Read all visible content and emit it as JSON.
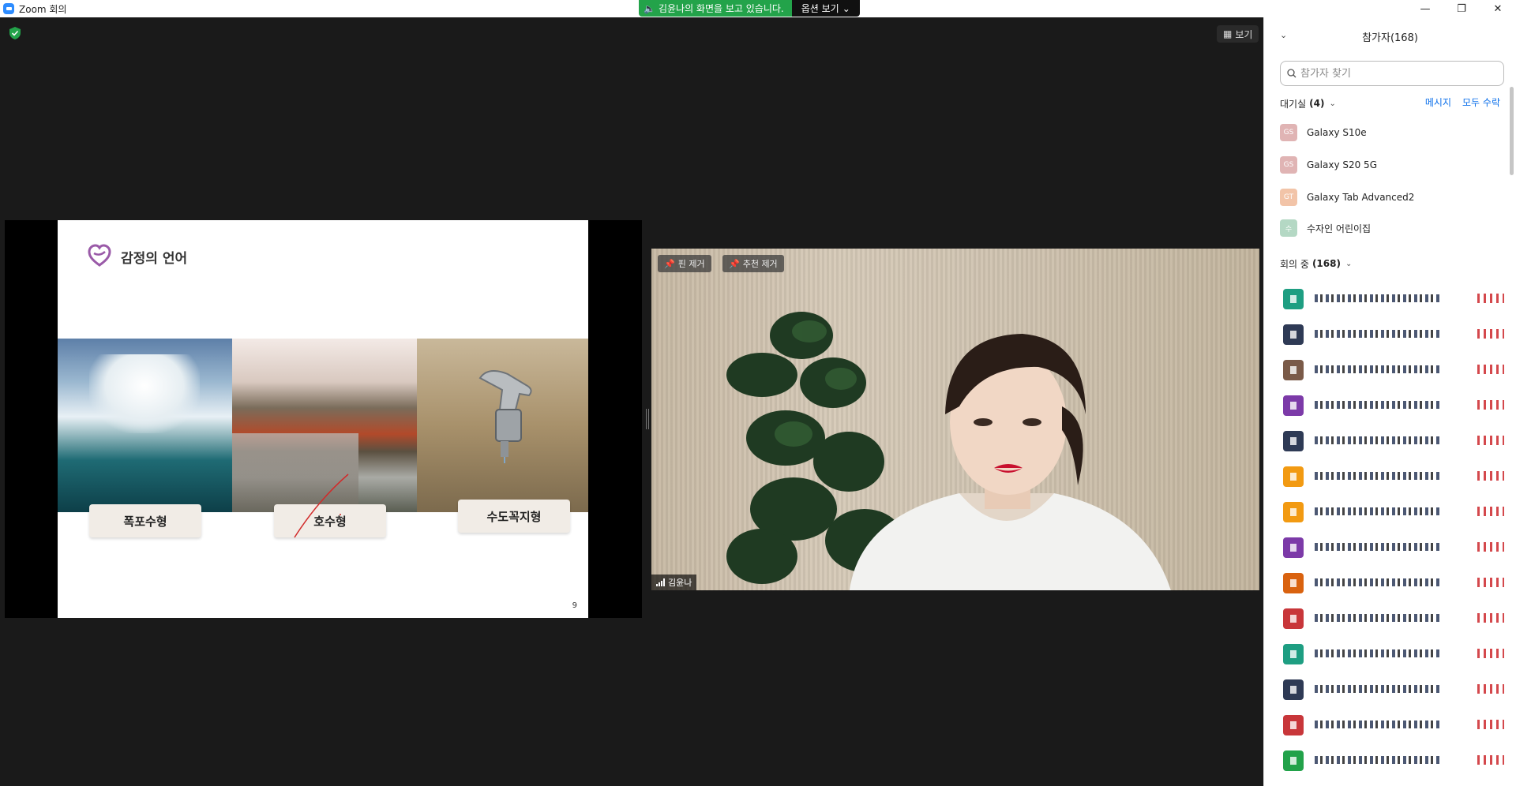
{
  "window": {
    "title": "Zoom 회의",
    "controls": {
      "minimize": "—",
      "restore": "❐",
      "close": "✕"
    }
  },
  "share_banner": {
    "text": "김윤나의 화면을 보고 있습니다.",
    "options_label": "옵션 보기"
  },
  "toolbar": {
    "view_label": "보기"
  },
  "slide": {
    "title": "감정의 언어",
    "labels": [
      "폭포수형",
      "호수형",
      "수도꼭지형"
    ],
    "page": "9"
  },
  "video": {
    "unpin_label": "핀 제거",
    "unspotlight_label": "추천 제거",
    "speaker_name": "김윤나"
  },
  "participants": {
    "title": "참가자(168)",
    "search_placeholder": "참가자 찾기",
    "waiting_room": {
      "label": "대기실",
      "count": "(4)"
    },
    "message_label": "메시지",
    "admit_all_label": "모두 수락",
    "waiting": [
      {
        "initials": "GS",
        "name": "Galaxy S10e",
        "color": "#e0b4b4"
      },
      {
        "initials": "GS",
        "name": "Galaxy S20 5G",
        "color": "#e0b4b4"
      },
      {
        "initials": "GT",
        "name": "Galaxy Tab Advanced2",
        "color": "#f2c4a8"
      },
      {
        "initials": "수",
        "name": "수자인 어린이집",
        "color": "#b4d8c4"
      }
    ],
    "in_meeting": {
      "label": "회의 중",
      "count": "(168)"
    },
    "member_colors": [
      "#1e9e82",
      "#2e3a55",
      "#7a5a48",
      "#7c3aa8",
      "#2e3a55",
      "#f29a12",
      "#f29a12",
      "#7c3aa8",
      "#d9620f",
      "#c8363a",
      "#1e9e82",
      "#2e3a55",
      "#c8363a",
      "#22a24a"
    ]
  }
}
